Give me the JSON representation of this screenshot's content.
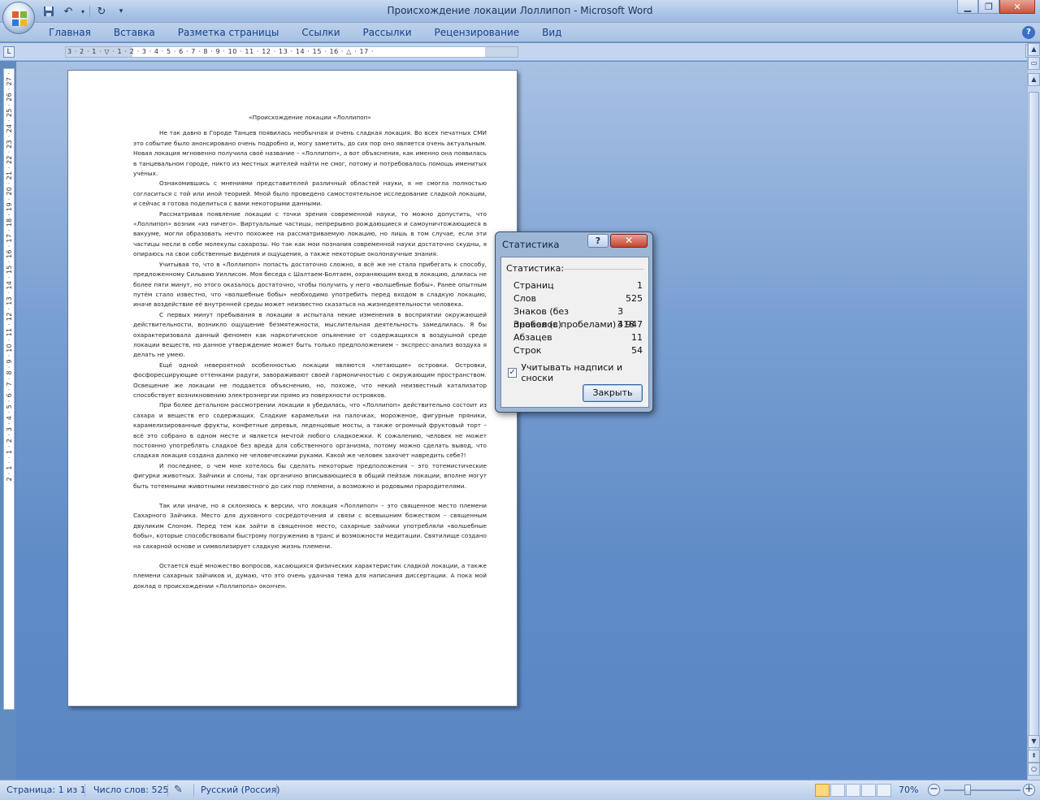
{
  "window": {
    "title": "Происхождение локации Лоллипоп - Microsoft Word"
  },
  "ribbon": {
    "tabs": [
      "Главная",
      "Вставка",
      "Разметка страницы",
      "Ссылки",
      "Рассылки",
      "Рецензирование",
      "Вид"
    ]
  },
  "ruler": {
    "horizontal_marks": "3 · 2 · 1 · ▽ · 1 · 2 · 3 · 4 · 5 · 6 · 7 · 8 · 9 · 10 · 11 · 12 · 13 · 14 · 15 · 16 · △ · 17 ·",
    "vertical_marks": "2 · 1 · · 1 · 2 · 3 · 4 · 5 · 6 · 7 · 8 · 9 · 10 · 11 · 12 · 13 · 14 · 15 · 16 · 17 · 18 · 19 · 20 · 21 · 22 · 23 · 24 · 25 · 26 · 27 ·"
  },
  "document": {
    "title": "«Происхождение локации «Лоллипоп»",
    "paragraphs": [
      "Не так давно в Городе Танцев появилась необычная и очень сладкая локация. Во всех печатных СМИ это событие было анонсировано очень подробно и, могу заметить, до сих пор оно является очень актуальным. Новая локация мгновенно получила своё название – «Лоллипоп», а вот объяснения, как именно она появилась в танцевальном городе, никто из местных жителей найти не смог, потому и потребовалось помощь именитых учёных.",
      "Ознакомившись с мнениями представителей различный областей науки, я не смогла полностью согласиться с той или иной теорией. Мной было проведено самостоятельное исследование сладкой локации, и сейчас я готова поделиться с вами некоторыми данными.",
      "Рассматривая появление локации с точки зрения современной науки, то можно допустить, что «Лоллипоп» возник «из ничего». Виртуальные частицы, непрерывно рождающиеся и самоуничтожающиеся в вакууме, могли образовать нечто похожее на рассматриваемую локацию, но лишь в том случае, если эти частицы несли в себе молекулы сахарозы. Но так как мои познания современной науки достаточно скудны, я опираюсь на свои собственные видения и ощущения, а также некоторые околонаучные знания.",
      "Учитывая то, что в «Лоллипоп» попасть достаточно сложно, я всё же не стала прибегать к способу, предложенному Сильвию Уиллисом. Моя беседа с Шалтаем-Болтаем, охраняющим вход в локацию, длилась не более пяти минут, но этого оказалось достаточно, чтобы получить у него «волшебные бобы». Ранее опытным путём стало известно, что «волшебные бобы» необходимо употребить перед входом в сладкую локацию, иначе воздействие её внутренней среды может неизвестно сказаться на жизнедеятельности человека.",
      "С первых минут пребывания в локации я испытала некие изменения в восприятии окружающей действительности, возникло ощущение безмятежности, мыслительная деятельность замедлилась. Я бы охарактеризовала данный феномен как наркотическое опьянение от содержащихся в воздушной среде локации веществ, но данное утверждение может быть только предположением – экспресс-анализ воздуха я делать не умею.",
      "Ещё одной невероятной особенностью локации являются «летающие» островки. Островки, фосфоресцирующие оттенками радуги, завораживают своей гармоничностью с окружающим пространством. Освещение же локации не поддается объяснению, но, похоже, что некий неизвестный катализатор способствует возникновению электроэнергии прямо из поверхности островков.",
      "При более детальном рассмотрении локации я убедилась, что «Лоллипоп» действительно состоит из сахара и веществ его содержащих. Сладкие карамельки на палочках, мороженое, фигурные пряники, карамелизированные фрукты, конфетные деревья, леденцовые мосты, а также огромный фруктовый торт – всё это собрано в одном месте и является мечтой любого сладкоежки. К сожалению, человек не может постоянно употреблять сладкое без вреда для собственного организма, потому можно сделать вывод, что сладкая локация создана далеко не человеческими руками. Какой же человек захочет навредить себе?!",
      "И последнее, о чем мне хотелось бы сделать некоторые предположения – это тотемистические фигурки животных. Зайчики и слоны, так органично вписывающиеся в общий пейзаж локации, вполне могут быть тотемными животными неизвестного до сих пор племени, а возможно и родовыми прародителями.",
      "Так или иначе, но я склоняюсь к версии, что локация «Лоллипоп» – это священное место племени Сахарного Зайчика. Место для духовного сосредоточения и связи с всевышним божеством – священным двуликим Слоном. Перед тем как зайти в священное место, сахарные зайчики употребляли «волшебные бобы», которые способствовали быстрому погружению в транс и возможности медитации. Святилище создано на сахарной основе и символизирует сладкую жизнь племени.",
      "Остается ещё множество вопросов, касающихся физических характеристик сладкой локации, а также племени сахарных зайчиков и, думаю, что это очень удачная тема для написания диссертации. А пока мой доклад о происхождении «Лоллипопа» окончен."
    ]
  },
  "dialog": {
    "title": "Статистика",
    "help_label": "?",
    "close_icon_label": "✕",
    "group_label": "Статистика:",
    "rows": [
      {
        "label": "Страниц",
        "value": "1"
      },
      {
        "label": "Слов",
        "value": "525"
      },
      {
        "label": "Знаков (без пробелов)",
        "value": "3 418"
      },
      {
        "label": "Знаков (с пробелами)",
        "value": "3 947"
      },
      {
        "label": "Абзацев",
        "value": "11"
      },
      {
        "label": "Строк",
        "value": "54"
      }
    ],
    "checkbox_label": "Учитывать надписи и сноски",
    "checkbox_checked": true,
    "close_button_label": "Закрыть"
  },
  "statusbar": {
    "page": "Страница: 1 из 1",
    "words": "Число слов: 525",
    "language": "Русский (Россия)",
    "zoom": "70%"
  },
  "colors": {
    "workspace": "#5f8bc0",
    "ribbon_text": "#15428b"
  }
}
